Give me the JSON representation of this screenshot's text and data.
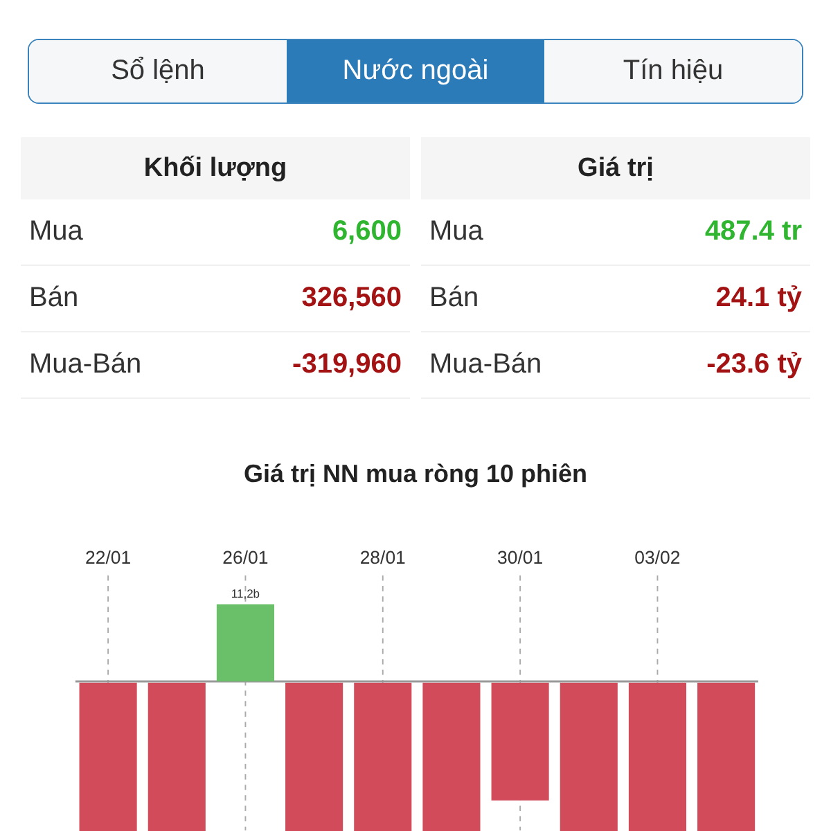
{
  "tabs": [
    {
      "label": "Sổ lệnh",
      "selected": false
    },
    {
      "label": "Nước ngoài",
      "selected": true
    },
    {
      "label": "Tín hiệu",
      "selected": false
    }
  ],
  "tables": [
    {
      "heading": "Khối lượng",
      "rows": [
        {
          "label": "Mua",
          "value": "6,600",
          "kind": "up"
        },
        {
          "label": "Bán",
          "value": "326,560",
          "kind": "down"
        },
        {
          "label": "Mua-Bán",
          "value": "-319,960",
          "kind": "down"
        }
      ]
    },
    {
      "heading": "Giá trị",
      "rows": [
        {
          "label": "Mua",
          "value": "487.4 tr",
          "kind": "up"
        },
        {
          "label": "Bán",
          "value": "24.1 tỷ",
          "kind": "down"
        },
        {
          "label": "Mua-Bán",
          "value": "-23.6 tỷ",
          "kind": "down"
        }
      ]
    }
  ],
  "chart": {
    "title": "Giá trị NN mua ròng 10 phiên",
    "date_labels": [
      "22/01",
      "26/01",
      "28/01",
      "30/01",
      "03/02"
    ],
    "bar_label": "11,2b",
    "bars": [
      {
        "kind": "negative"
      },
      {
        "kind": "negative"
      },
      {
        "kind": "positive"
      },
      {
        "kind": "negative"
      },
      {
        "kind": "negative"
      },
      {
        "kind": "negative"
      },
      {
        "kind": "negative"
      },
      {
        "kind": "negative"
      },
      {
        "kind": "negative"
      },
      {
        "kind": "negative"
      }
    ]
  }
}
